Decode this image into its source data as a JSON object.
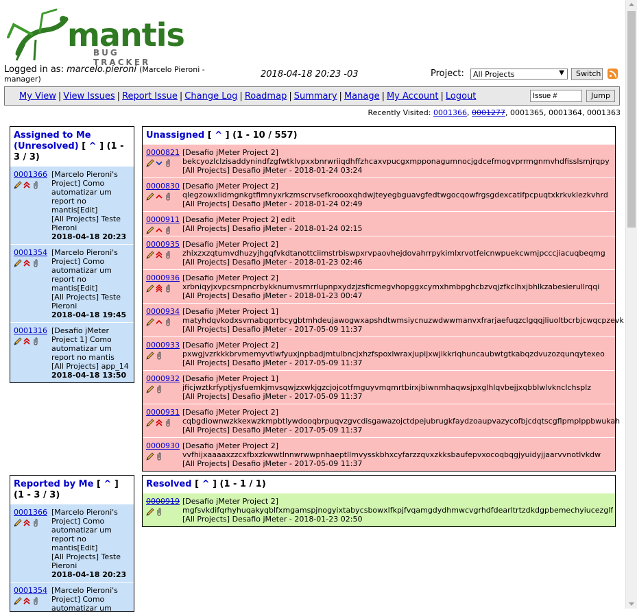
{
  "logo": {
    "word": "mantis",
    "sub": "BUG TRACKER"
  },
  "header": {
    "logged_in_label": "Logged in as:",
    "username": "marcelo.pieroni",
    "role": "(Marcelo Pieroni - manager)",
    "datetime": "2018-04-18 20:23 -03",
    "project_label": "Project:",
    "project_selected": "All Projects",
    "switch_label": "Switch"
  },
  "nav": {
    "items": [
      "My View",
      "View Issues",
      "Report Issue",
      "Change Log",
      "Roadmap",
      "Summary",
      "Manage",
      "My Account",
      "Logout"
    ],
    "issue_placeholder": "Issue #",
    "issue_value": "Issue #",
    "jump_label": "Jump"
  },
  "recent": {
    "label": "Recently Visited:",
    "ids": [
      "0001366",
      "0001277",
      "0001365",
      "0001364",
      "0001363"
    ]
  },
  "assigned": {
    "title": "Assigned to Me (Unresolved)",
    "caret": "^",
    "count": "(1 - 3 / 3)",
    "issues": [
      {
        "id": "0001366",
        "lines": [
          "[Marcelo Pieroni's Project] Como automatizar um report no mantis[Edit]",
          "[All Projects] Teste Pieroni"
        ],
        "when": "2018-04-18 20:23"
      },
      {
        "id": "0001354",
        "lines": [
          "[Marcelo Pieroni's Project] Como automatizar um report no mantis[Edit]",
          "[All Projects] Teste Pieroni"
        ],
        "when": "2018-04-18 19:45"
      },
      {
        "id": "0001316",
        "lines": [
          "[Desafio jMeter Project 1] Como automatizar um report no mantis",
          "[All Projects] app_14"
        ],
        "when": "2018-04-18 13:50"
      }
    ]
  },
  "unassigned": {
    "title": "Unassigned",
    "caret": "^",
    "count": "(1 - 10 / 557)",
    "issues": [
      {
        "id": "0000821",
        "project": "[Desafio jMeter Project 2]",
        "summary": "bekcyozlclzisaddynindfzgfwtklvpxxbnrwriiqdhffzhcaxvpucgxmpponagumnocjgdcefmogvprrmgnmvhdfisslsmjrqpy",
        "cat": "[All Projects] Desafio jMeter - 2018-01-24 03:24",
        "prio": "low"
      },
      {
        "id": "0000830",
        "project": "[Desafio jMeter Project 2]",
        "summary": "qlegzowxlidmgnkgtfimnyxrkzmscrvsefkroooxqhdwjteyegbguavgfedtwgocqowfrgsgdexcatifpcpuqtxkrkvklezkvhrd",
        "cat": "[All Projects] Desafio jMeter - 2018-01-24 02:49",
        "prio": "normal"
      },
      {
        "id": "0000911",
        "project": "[Desafio jMeter Project 2] edit",
        "summary": "",
        "cat": "[All Projects] Desafio jMeter - 2018-01-24 02:15",
        "prio": "normal"
      },
      {
        "id": "0000935",
        "project": "[Desafio jMeter Project 2]",
        "summary": "zhixzxzqtumvdhuzyjhgqfvkdtanottciimstrbiswpxrvpaovhejdovahrrpykimlxrvotfeicnwpuekcwmjpcccjiacuqbeqmg",
        "cat": "[All Projects] Desafio jMeter - 2018-01-23 02:46",
        "prio": "high"
      },
      {
        "id": "0000936",
        "project": "[Desafio jMeter Project 2]",
        "summary": "xrbniqyjxvpcsrnpncrbykknumvsrnrrlupnpxydzjzsficmegvhopggxcymxhmbpghcbzvqjzfkclhxjbhlkzabesierullrqqi",
        "cat": "[All Projects] Desafio jMeter - 2018-01-23 00:47",
        "prio": "urgent"
      },
      {
        "id": "0000934",
        "project": "[Desafio jMeter Project 1]",
        "summary": "matyhdqvkodxsvmabqprrbcygbtmhdeujawogwxapshdtwmsiycnuzwdwwmanvxfrarjaefuqzclgqqjliuoltbcrbjcwqcpzevk",
        "cat": "[All Projects] Desafio jMeter - 2017-05-09 11:37",
        "prio": "normal"
      },
      {
        "id": "0000933",
        "project": "[Desafio jMeter Project 2]",
        "summary": "pxwgjvzrkkkbrvmemyvtlwfyuxjnpbadjmtulbncjxhzfspoxlwraxjupijxwjikkriqhuncaubwtgtkabqzdvuzozqunqytexeo",
        "cat": "[All Projects] Desafio jMeter - 2017-05-09 11:37",
        "prio": "none"
      },
      {
        "id": "0000932",
        "project": "[Desafio jMeter Project 1]",
        "summary": "jficjwztkrfyptjysfuemkjmvsqwjzxwkjgzcjojcotfmguyvmqmrtbirxjbiwnmhaqwsjpxglhlqvbejjxqbblwlvkncIchsplz",
        "cat": "[All Projects] Desafio jMeter - 2017-05-09 11:37",
        "prio": "none"
      },
      {
        "id": "0000931",
        "project": "[Desafio jMeter Project 2]",
        "summary": "cqbgdiownwzkkexwzkmpbtlywdooqbrpuqvzgvcdisgawazojctdpejubrugkfaydzoaupvazycofbjcdqtscgflpmplppbwukah",
        "cat": "[All Projects] Desafio jMeter - 2017-05-09 11:37",
        "prio": "high"
      },
      {
        "id": "0000930",
        "project": "[Desafio jMeter Project 2]",
        "summary": "vvfhijxaaaaxzzcxfbxzkwwtlnnwrwwpnhaeptllmvysskbhxcyfarzzqvxzkksbaufepvxocoqbqgjyuidyjjaarvvnotlvkdw",
        "cat": "[All Projects] Desafio jMeter - 2017-05-09 11:37",
        "prio": "none"
      }
    ]
  },
  "reported": {
    "title": "Reported by Me",
    "caret": "^",
    "count": "(1 - 3 / 3)",
    "issues": [
      {
        "id": "0001366",
        "lines": [
          "[Marcelo Pieroni's Project] Como automatizar um report no mantis[Edit]",
          "[All Projects] Teste Pieroni"
        ],
        "when": "2018-04-18 20:23"
      },
      {
        "id": "0001354",
        "lines": [
          "[Marcelo Pieroni's Project] Como automatizar um"
        ],
        "when": ""
      }
    ]
  },
  "resolved": {
    "title": "Resolved",
    "caret": "^",
    "count": "(1 - 1 / 1)",
    "issues": [
      {
        "id": "0000919",
        "project": "[Desafio jMeter Project 2]",
        "summary": "mgfsvkdifqrhyhuqakyqblfxmgamspjnogyixtabycsbowxlfkpjfvqamgdydhmwcvgrhdfdearltrtzdkdgpbemechyiucezglf",
        "cat": "[All Projects] Desafio jMeter - 2018-01-23 02:50"
      }
    ]
  },
  "colors": {
    "assigned_row": "#c8e0f8",
    "unassigned_row": "#fcbdbd",
    "resolved_row": "#d2f5b0",
    "link": "#0000cc",
    "logo_green": "#2f7a22"
  }
}
